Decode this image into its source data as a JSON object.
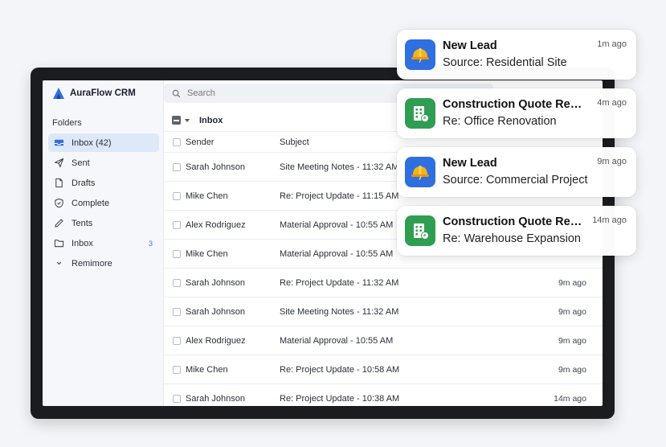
{
  "app": {
    "name": "AuraFlow CRM"
  },
  "search": {
    "placeholder": "Search"
  },
  "sidebar": {
    "title": "Folders",
    "items": [
      {
        "label": "Inbox (42)",
        "icon": "inbox-icon",
        "active": true
      },
      {
        "label": "Sent",
        "icon": "send-icon"
      },
      {
        "label": "Drafts",
        "icon": "draft-icon"
      },
      {
        "label": "Complete",
        "icon": "shield-icon"
      },
      {
        "label": "Tents",
        "icon": "pencil-icon"
      },
      {
        "label": "Inbox",
        "icon": "folder-icon",
        "count": "3"
      },
      {
        "label": "Remimore",
        "icon": "chevron-down-icon"
      }
    ]
  },
  "toolbar": {
    "label": "Inbox"
  },
  "columns": {
    "sender": "Sender",
    "subject": "Subject"
  },
  "emails": [
    {
      "sender": "Sarah Johnson",
      "subject": "Site Meeting Notes - 11:32 AM",
      "time": ""
    },
    {
      "sender": "Mike Chen",
      "subject": "Re: Project Update - 11:15 AM",
      "time": ""
    },
    {
      "sender": "Alex Rodriguez",
      "subject": "Material Approval - 10:55 AM",
      "time": ""
    },
    {
      "sender": "Mike Chen",
      "subject": "Material Approval - 10:55 AM",
      "time": ""
    },
    {
      "sender": "Sarah Johnson",
      "subject": "Re: Project Update - 11:32 AM",
      "time": "9m ago"
    },
    {
      "sender": "Sarah Johnson",
      "subject": "Site Meeting Notes - 11:32 AM",
      "time": "9m ago"
    },
    {
      "sender": "Alex Rodriguez",
      "subject": "Material Approval - 10:55 AM",
      "time": "9m ago"
    },
    {
      "sender": "Mike Chen",
      "subject": "Re: Project Update - 10:58 AM",
      "time": "9m ago"
    },
    {
      "sender": "Sarah Johnson",
      "subject": "Re: Project Update - 10:38 AM",
      "time": "14m ago"
    }
  ],
  "notifications": [
    {
      "title": "New Lead",
      "subtitle": "Source: Residential Site",
      "time": "1m ago",
      "icon": "hard-hat-icon",
      "color": "#2f6fe0"
    },
    {
      "title": "Construction Quote Request",
      "subtitle": "Re: Office Renovation",
      "time": "4m ago",
      "icon": "building-icon",
      "color": "#2f9e52"
    },
    {
      "title": "New Lead",
      "subtitle": "Source: Commercial Project",
      "time": "9m ago",
      "icon": "hard-hat-icon",
      "color": "#2f6fe0"
    },
    {
      "title": "Construction Quote Request",
      "subtitle": "Re: Warehouse Expansion",
      "time": "14m ago",
      "icon": "building-icon",
      "color": "#2f9e52"
    }
  ],
  "colors": {
    "accent": "#2f6fe0",
    "active_bg": "#dde8f8",
    "success": "#2f9e52"
  }
}
